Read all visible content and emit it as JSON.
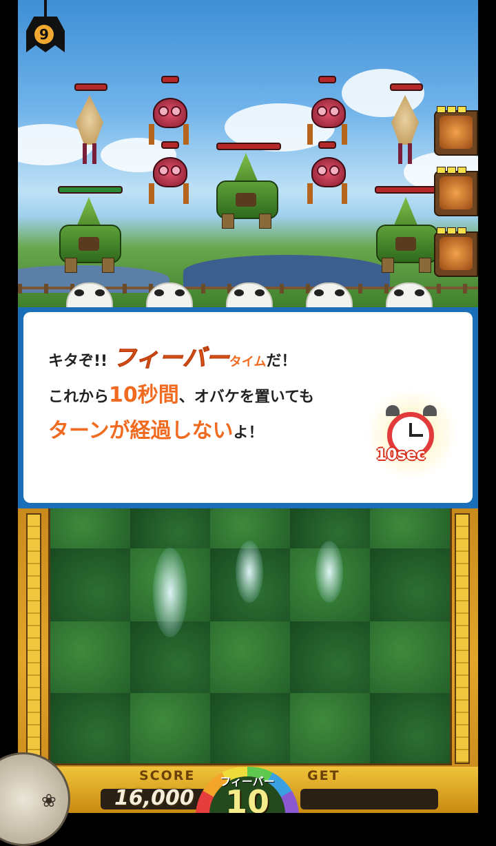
{
  "turn_counter": {
    "value": "9"
  },
  "dialog": {
    "line1": {
      "prefix": "キタぞ!! ",
      "fever": "フィーバー",
      "time": "タイム",
      "suffix": "だ！"
    },
    "line2": {
      "prefix": "これから",
      "seconds": "10秒間",
      "suffix": "、オバケを置いても"
    },
    "line3": {
      "highlight": "ターンが経過しない",
      "suffix": "よ！"
    },
    "timer_badge": "10sec"
  },
  "status_bar": {
    "score_label": "SCORE",
    "score_value": "16,000",
    "fever_label": "フィーバー",
    "fever_count": "10",
    "get_label": "GET"
  },
  "side_cards": [
    {
      "icon": "clock-card-icon",
      "charges": 3
    },
    {
      "icon": "map-card-icon",
      "charges": 3
    },
    {
      "icon": "leaf-card-icon",
      "charges": 3
    }
  ],
  "enemies": [
    {
      "type": "squid",
      "icon": "squid-enemy-icon"
    },
    {
      "type": "crab",
      "icon": "crab-enemy-icon"
    },
    {
      "type": "crab",
      "icon": "crab-enemy-icon"
    },
    {
      "type": "turtle",
      "icon": "turtle-enemy-icon"
    },
    {
      "type": "crab",
      "icon": "crab-enemy-icon"
    },
    {
      "type": "crab",
      "icon": "crab-enemy-icon"
    },
    {
      "type": "squid",
      "icon": "squid-enemy-icon"
    },
    {
      "type": "turtle",
      "icon": "turtle-enemy-icon"
    },
    {
      "type": "turtle",
      "icon": "turtle-enemy-icon"
    }
  ],
  "colors": {
    "accent_orange": "#f06a20",
    "dialog_border": "#1a6fb8",
    "board_gold": "#e3a52b"
  }
}
